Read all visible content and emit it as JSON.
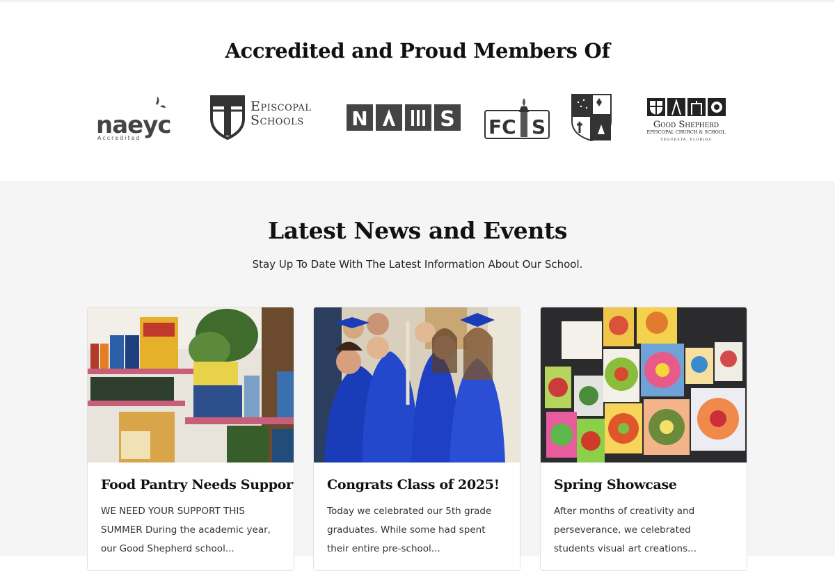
{
  "accreditation": {
    "heading": "Accredited and Proud Members Of",
    "logos": {
      "naeyc": {
        "name": "naeyc",
        "sub": "Accredited"
      },
      "episcopal": {
        "line1": "Episcopal",
        "line2": "Schools"
      },
      "nais": {
        "letters": [
          "N",
          "A",
          "I",
          "S"
        ]
      },
      "fcis": {
        "left": "FC",
        "right": "S"
      },
      "goodshepherd": {
        "name": "Good Shepherd",
        "line2": "EPISCOPAL CHURCH & SCHOOL",
        "line3": "TEQUESTA, FLORIDA"
      }
    }
  },
  "news": {
    "heading": "Latest News and Events",
    "subheading": "Stay Up To Date With The Latest Information About Our School.",
    "cards": [
      {
        "title": "Food Pantry Needs Support",
        "excerpt": "WE NEED YOUR SUPPORT THIS SUMMER During the academic year, our Good Shepherd school..."
      },
      {
        "title": "Congrats Class of 2025!",
        "excerpt": "Today we celebrated our 5th grade graduates. While some had spent their entire pre-school..."
      },
      {
        "title": "Spring Showcase",
        "excerpt": "After months of creativity and perseverance, we celebrated students visual art creations..."
      }
    ]
  }
}
